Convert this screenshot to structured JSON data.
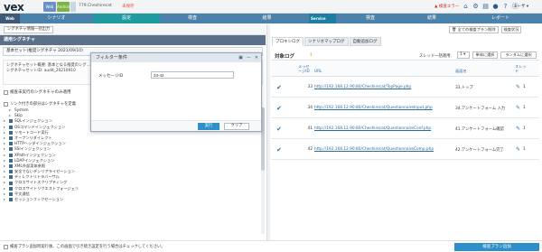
{
  "header": {
    "logo_text": "vex",
    "badge_a": "Web",
    "badge_b": "Android",
    "project_name": "779.Cheshirecat",
    "unsaved": "未保存",
    "warn_label": "検査エラー",
    "icons": [
      "home-icon",
      "settings-icon",
      "database-icon",
      "user-icon",
      "help-icon",
      "info-icon"
    ],
    "user_label": "ユーザ"
  },
  "steps": {
    "web": "Web",
    "scenario": "シナリオ",
    "settings": "設定",
    "scan": "検査",
    "result": "結果",
    "service": "Service",
    "scan2": "検査",
    "result2": "結果",
    "report": "レポート"
  },
  "left": {
    "bulk_button": "シグネチャ情報一括出力",
    "panel_title": "適用シグネチャ",
    "preset": "基本セット(推奨シグネチャ 2021/09/10)",
    "desc_line1": "シグネチャセット概要: 基本となる推奨のシグ…",
    "desc_line2": "シグネチャセットID: audit_20210910",
    "desc_more": "詳細",
    "only_scan_label": "検査未実行のシグネチャのみ適用",
    "tree_note": "リンク付きの部分はシグネチャを定義",
    "tree": [
      {
        "label": "System",
        "indent": true,
        "square": false
      },
      {
        "label": "Skip",
        "indent": true,
        "square": false
      },
      {
        "label": "SQLインジェクション",
        "indent": false,
        "square": true
      },
      {
        "label": "OSコマンドインジェクション",
        "indent": false,
        "square": true
      },
      {
        "label": "リモートコード実行",
        "indent": false,
        "square": true
      },
      {
        "label": "オープンリダイレクト",
        "indent": false,
        "square": true
      },
      {
        "label": "HTTPヘッダインジェクション",
        "indent": false,
        "square": true
      },
      {
        "label": "SSIインジェクション",
        "indent": false,
        "square": true
      },
      {
        "label": "XPathインジェクション",
        "indent": false,
        "square": true
      },
      {
        "label": "LDAPインジェクション",
        "indent": false,
        "square": true
      },
      {
        "label": "XML外部実体参照",
        "indent": false,
        "square": true
      },
      {
        "label": "安全でないデシリアライゼーション",
        "indent": false,
        "square": true
      },
      {
        "label": "ディレクトリトラバーサル",
        "indent": false,
        "square": true
      },
      {
        "label": "クロスサイトスクリプティング",
        "indent": false,
        "square": true
      },
      {
        "label": "クロスサイトリクエストフォージェリ",
        "indent": false,
        "square": true
      },
      {
        "label": "平文通信",
        "indent": false,
        "square": true
      },
      {
        "label": "セッションフィクセーション",
        "indent": false,
        "square": true
      }
    ]
  },
  "dialog": {
    "title": "フィルター条件",
    "message_id_label": "メッセージID",
    "message_id_value": "33-42",
    "run_label": "実行",
    "clear_label": "クリア"
  },
  "bottom": {
    "note": "検査プラン追加時実行後、この画面で引き続き設定を行う場合はチェックしてください。",
    "add_plan_button": "検査プラン追加"
  },
  "right": {
    "tabs": [
      "プロキシログ",
      "シナリオマップログ",
      "自動追加ログ"
    ],
    "actions": [
      "全ての検査プラン削除",
      "検査状況"
    ],
    "title": "対象ログ",
    "thread_label": "スレッド一括適用:",
    "thread_value": "1",
    "btn_single": "単体に選択",
    "btn_random": "ランダムに選択",
    "columns": {
      "msg_id": "メッセージID",
      "url": "URL",
      "page_name": "画面名",
      "thread": "スレッド"
    },
    "rows": [
      {
        "id": "33",
        "url": "http://192.168.12.90:80/Cheshirecat/TopPage.php",
        "page": "33.トップ",
        "count": "1"
      },
      {
        "id": "34",
        "url": "http://192.168.12.90:80/Cheshirecat/QuestionnaireInput.php",
        "page": "34.アンケートフォーム 入力",
        "count": "1"
      },
      {
        "id": "41",
        "url": "http://192.168.12.90:80/Cheshirecat/QuestionnaireConf.php",
        "page": "41.アンケートフォーム確認",
        "count": "1"
      },
      {
        "id": "42",
        "url": "http://192.168.12.90:80/Cheshirecat/QuestionnaireComp.php",
        "page": "42.アンケートフォーム完了",
        "count": "1"
      }
    ]
  }
}
